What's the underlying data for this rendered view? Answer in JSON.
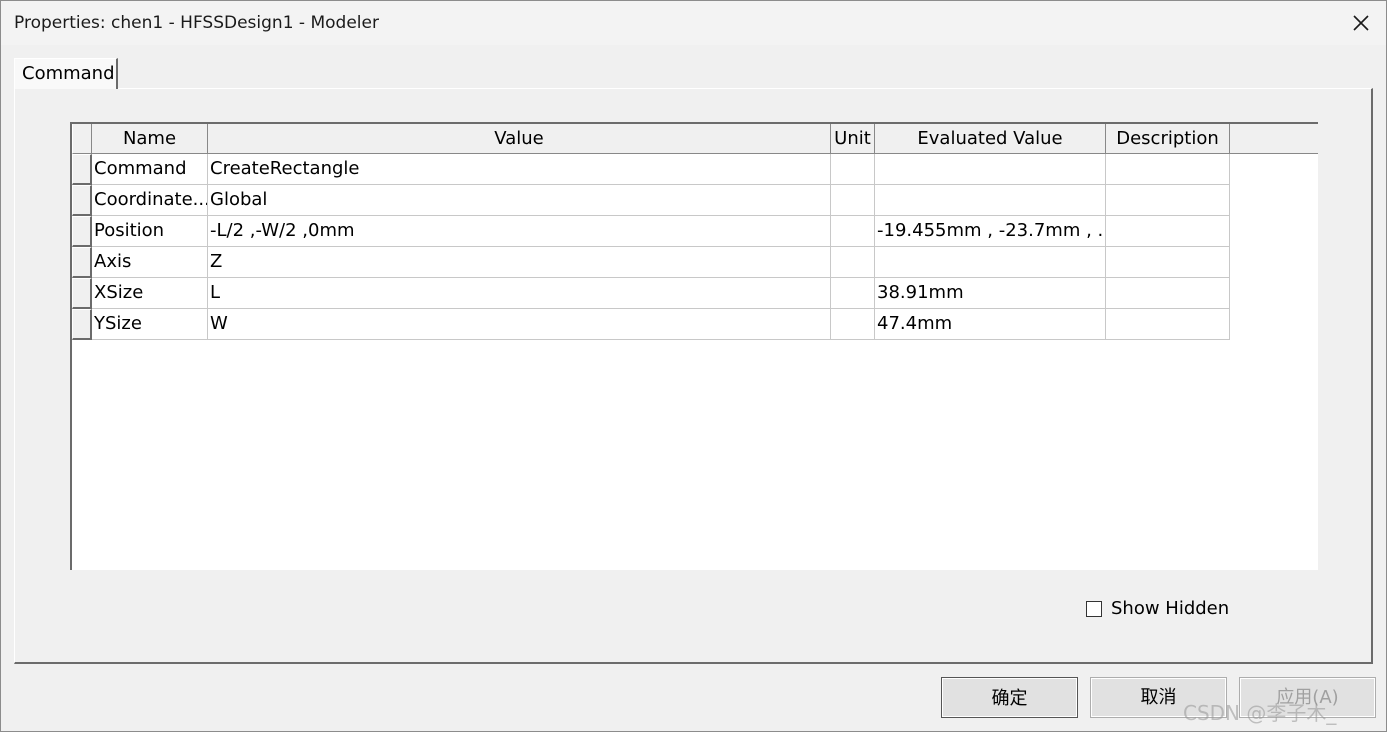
{
  "window": {
    "title": "Properties: chen1 - HFSSDesign1 - Modeler"
  },
  "tabs": [
    {
      "label": "Command"
    }
  ],
  "table": {
    "columns": [
      "Name",
      "Value",
      "Unit",
      "Evaluated Value",
      "Description"
    ],
    "rows": [
      {
        "name": "Command",
        "value": "CreateRectangle",
        "unit": "",
        "evaluated": "",
        "description": ""
      },
      {
        "name": "Coordinate...",
        "value": "Global",
        "unit": "",
        "evaluated": "",
        "description": ""
      },
      {
        "name": "Position",
        "value": "-L/2 ,-W/2 ,0mm",
        "unit": "",
        "evaluated": "-19.455mm , -23.7mm , ...",
        "description": ""
      },
      {
        "name": "Axis",
        "value": "Z",
        "unit": "",
        "evaluated": "",
        "description": ""
      },
      {
        "name": "XSize",
        "value": "L",
        "unit": "",
        "evaluated": "38.91mm",
        "description": ""
      },
      {
        "name": "YSize",
        "value": "W",
        "unit": "",
        "evaluated": "47.4mm",
        "description": ""
      }
    ]
  },
  "show_hidden": {
    "label": "Show Hidden",
    "checked": false
  },
  "buttons": {
    "ok": "确定",
    "cancel": "取消",
    "apply": "应用(A)"
  },
  "watermark": "CSDN @李子木_",
  "icons": {
    "close": "close-icon"
  }
}
